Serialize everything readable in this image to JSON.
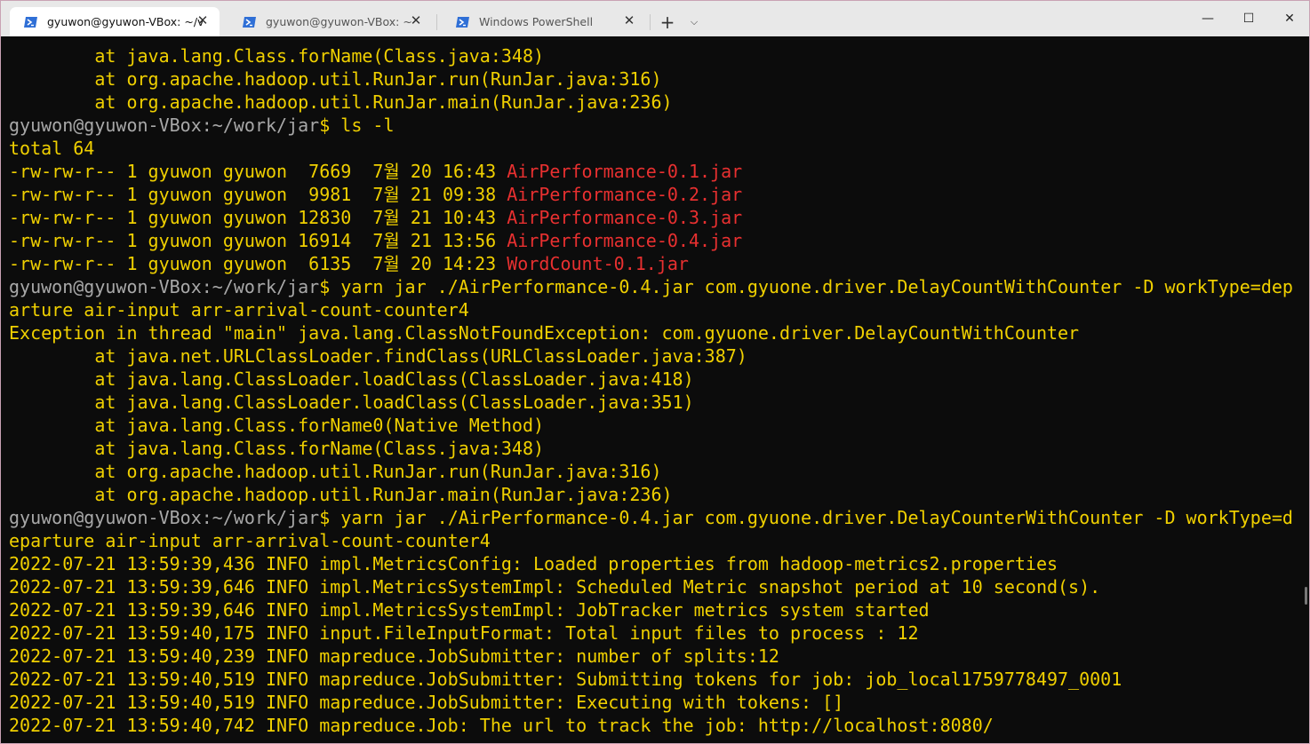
{
  "tabs": [
    {
      "title": "gyuwon@gyuwon-VBox: ~/v",
      "icon": "powershell-icon",
      "active": true
    },
    {
      "title": "gyuwon@gyuwon-VBox: ~",
      "icon": "powershell-icon",
      "active": false
    },
    {
      "title": "Windows PowerShell",
      "icon": "powershell-icon",
      "active": false
    }
  ],
  "tab_close_glyph": "✕",
  "new_tab_glyph": "+",
  "dropdown_glyph": "⌵",
  "window_controls": {
    "minimize": "—",
    "maximize": "☐",
    "close": "✕"
  },
  "colors": {
    "terminal_bg": "#0c0c0c",
    "text_yellow": "#f0d000",
    "prompt_gray": "#a8a8a8",
    "jar_red": "#e83030"
  },
  "terminal": {
    "lines": [
      {
        "text": "        at java.lang.Class.forName(Class.java:348)"
      },
      {
        "text": "        at org.apache.hadoop.util.RunJar.run(RunJar.java:316)"
      },
      {
        "text": "        at org.apache.hadoop.util.RunJar.main(RunJar.java:236)"
      },
      {
        "prompt": "gyuwon@gyuwon-VBox:~/work/jar",
        "text": "$ ls -l"
      },
      {
        "text": "total 64"
      },
      {
        "text": "-rw-rw-r-- 1 gyuwon gyuwon  7669  7월 20 16:43 ",
        "file": "AirPerformance-0.1.jar"
      },
      {
        "text": "-rw-rw-r-- 1 gyuwon gyuwon  9981  7월 21 09:38 ",
        "file": "AirPerformance-0.2.jar"
      },
      {
        "text": "-rw-rw-r-- 1 gyuwon gyuwon 12830  7월 21 10:43 ",
        "file": "AirPerformance-0.3.jar"
      },
      {
        "text": "-rw-rw-r-- 1 gyuwon gyuwon 16914  7월 21 13:56 ",
        "file": "AirPerformance-0.4.jar"
      },
      {
        "text": "-rw-rw-r-- 1 gyuwon gyuwon  6135  7월 20 14:23 ",
        "file": "WordCount-0.1.jar"
      },
      {
        "prompt": "gyuwon@gyuwon-VBox:~/work/jar",
        "text": "$ yarn jar ./AirPerformance-0.4.jar com.gyuone.driver.DelayCountWithCounter -D workType=dep"
      },
      {
        "text": "arture air-input arr-arrival-count-counter4"
      },
      {
        "text": "Exception in thread \"main\" java.lang.ClassNotFoundException: com.gyuone.driver.DelayCountWithCounter"
      },
      {
        "text": "        at java.net.URLClassLoader.findClass(URLClassLoader.java:387)"
      },
      {
        "text": "        at java.lang.ClassLoader.loadClass(ClassLoader.java:418)"
      },
      {
        "text": "        at java.lang.ClassLoader.loadClass(ClassLoader.java:351)"
      },
      {
        "text": "        at java.lang.Class.forName0(Native Method)"
      },
      {
        "text": "        at java.lang.Class.forName(Class.java:348)"
      },
      {
        "text": "        at org.apache.hadoop.util.RunJar.run(RunJar.java:316)"
      },
      {
        "text": "        at org.apache.hadoop.util.RunJar.main(RunJar.java:236)"
      },
      {
        "prompt": "gyuwon@gyuwon-VBox:~/work/jar",
        "text": "$ yarn jar ./AirPerformance-0.4.jar com.gyuone.driver.DelayCounterWithCounter -D workType=d"
      },
      {
        "text": "eparture air-input arr-arrival-count-counter4"
      },
      {
        "text": "2022-07-21 13:59:39,436 INFO impl.MetricsConfig: Loaded properties from hadoop-metrics2.properties"
      },
      {
        "text": "2022-07-21 13:59:39,646 INFO impl.MetricsSystemImpl: Scheduled Metric snapshot period at 10 second(s)."
      },
      {
        "text": "2022-07-21 13:59:39,646 INFO impl.MetricsSystemImpl: JobTracker metrics system started"
      },
      {
        "text": "2022-07-21 13:59:40,175 INFO input.FileInputFormat: Total input files to process : 12"
      },
      {
        "text": "2022-07-21 13:59:40,239 INFO mapreduce.JobSubmitter: number of splits:12"
      },
      {
        "text": "2022-07-21 13:59:40,519 INFO mapreduce.JobSubmitter: Submitting tokens for job: job_local1759778497_0001"
      },
      {
        "text": "2022-07-21 13:59:40,519 INFO mapreduce.JobSubmitter: Executing with tokens: []"
      },
      {
        "text": "2022-07-21 13:59:40,742 INFO mapreduce.Job: The url to track the job: http://localhost:8080/"
      }
    ]
  }
}
